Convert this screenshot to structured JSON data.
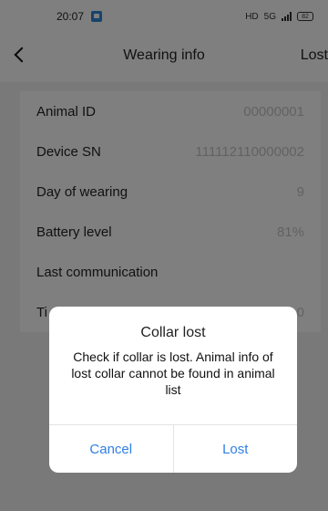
{
  "status_bar": {
    "time": "20:07",
    "network": "HD",
    "network_gen": "5G",
    "battery": "82"
  },
  "header": {
    "title": "Wearing info",
    "action": "Lost"
  },
  "info": {
    "rows": [
      {
        "label": "Animal ID",
        "value": "00000001"
      },
      {
        "label": "Device SN",
        "value": "111112110000002"
      },
      {
        "label": "Day of wearing",
        "value": "9"
      },
      {
        "label": "Battery level",
        "value": "81%"
      },
      {
        "label": "Last communication",
        "value": ""
      },
      {
        "label": "Ti",
        "value": "0"
      }
    ]
  },
  "dialog": {
    "title": "Collar lost",
    "message": "Check if collar is lost. Animal info of lost collar cannot be found in animal list",
    "cancel_label": "Cancel",
    "confirm_label": "Lost"
  },
  "colors": {
    "accent": "#2f7fe6",
    "overlay": "#000000",
    "value_text": "#c4c4c4"
  }
}
